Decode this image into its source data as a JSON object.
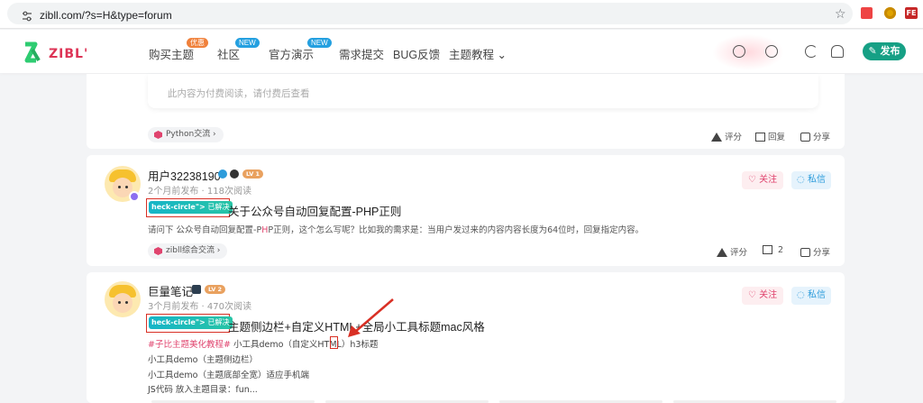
{
  "browser": {
    "url": "zibll.com/?s=H&type=forum",
    "ext3_label": "FE"
  },
  "header": {
    "nav": [
      {
        "label": "购买主题",
        "badge": "优惠",
        "active": true
      },
      {
        "label": "社区",
        "badge": "NEW"
      },
      {
        "label": "官方演示",
        "badge": "NEW"
      },
      {
        "label": "需求提交"
      },
      {
        "label": "BUG反馈"
      },
      {
        "label": "主题教程 ⌄"
      }
    ],
    "publish": "✎ 发布"
  },
  "post0": {
    "pay_text": "此内容为付费阅读，请付费后查看",
    "tag": "Python交流 ›",
    "actions": {
      "rate": "评分",
      "reply": "回复",
      "share": "分享"
    }
  },
  "post1": {
    "user": "用户32238190",
    "level": "LV 1",
    "meta": "2个月前发布 · 118次阅读",
    "follow": "♡ 关注",
    "dm": "◌ 私信",
    "solved_code": "heck-circle\">",
    "solved_text": "已解决",
    "title": "关于公众号自动回复配置-PHP正则",
    "excerpt_a": "请问下 公众号自动回复配置-P",
    "excerpt_hl": "H",
    "excerpt_b": "P正则，这个怎么写呢？比如我的需求是：当用户发过来的内容内容长度为64位时，回复指定内容。",
    "tag": "zibll综合交流 ›",
    "actions": {
      "rate": "评分",
      "reply": "2",
      "share": "分享"
    }
  },
  "post2": {
    "user": "巨量笔记",
    "level": "LV 2",
    "meta": "3个月前发布 · 470次阅读",
    "follow": "♡ 关注",
    "dm": "◌ 私信",
    "solved_code": "heck-circle\">",
    "solved_text": "已解决",
    "title": "主题侧边栏+自定义HTML+全局小工具标题mac风格",
    "line1_tag": "#子比主题美化教程#",
    "line1_a": " 小工具demo（自定义",
    "line1_h": "H",
    "line1_b": "TML）h3标题",
    "line2": "小工具demo（主题侧边栏）",
    "line3": "小工具demo（主题底部全宽）适应手机端",
    "line4": "JS代码 放入主题目录：fun..."
  },
  "colors": {
    "accent": "#2d9cdb",
    "pink": "#e0446e",
    "green": "#16a085",
    "annot": "#d93025"
  }
}
